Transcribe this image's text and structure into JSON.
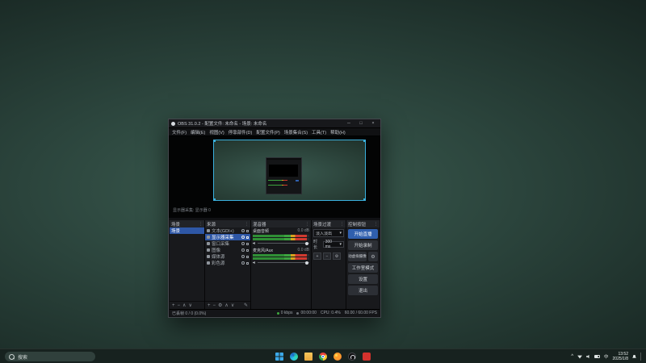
{
  "icons": {
    "minimize": "─",
    "maximize": "□",
    "close": "×",
    "menu_dots": "⋮",
    "plus": "+",
    "minus": "−",
    "gear": "⚙",
    "up": "∧",
    "down": "∨",
    "caret": "▾",
    "edit": "✎",
    "chevron_up": "^"
  },
  "colors": {
    "accent_blue": "#2f5fae",
    "selection_blue": "#2e57a6",
    "preview_outline": "#3ab0dd",
    "meter_green": "#3da33f",
    "meter_yellow": "#d8a21f",
    "meter_red": "#cf3a30"
  },
  "obs": {
    "title": "OBS 31.0.2 - 配置文件: 未命名 - 场景: 未命名",
    "menu": [
      "文件(F)",
      "编辑(E)",
      "视图(V)",
      "停靠部件(D)",
      "配置文件(P)",
      "场景集合(S)",
      "工具(T)",
      "帮助(H)"
    ],
    "preview": {
      "toolbar_text": "显示器采集: 显示器 0"
    },
    "scenes": {
      "title": "场景",
      "rows": [
        "场景"
      ]
    },
    "sources": {
      "title": "来源",
      "rows": [
        "文本(GDI+)",
        "显示器采集",
        "窗口采集",
        "图像",
        "媒体源",
        "彩色源"
      ]
    },
    "mixer": {
      "title": "混音器",
      "channels": [
        {
          "name": "桌面音频",
          "db": "0.0 dB"
        },
        {
          "name": "麦克风/Aux",
          "db": "0.0 dB"
        }
      ]
    },
    "transitions": {
      "title": "场景过渡",
      "selected": "淡入淡出",
      "duration_label": "时长",
      "duration": "300 ms"
    },
    "controls": {
      "title": "控制按钮",
      "stream": "开始直播",
      "record": "开始录制",
      "vcam": "启动虚拟摄像机",
      "studio": "工作室模式",
      "settings": "设置",
      "exit": "退出"
    },
    "status": {
      "dropped": "已丢帧 0 / 0 (0.0%)",
      "bitrate": "0 kbps",
      "timer": "00:00:00",
      "cpu": "CPU: 0.4%",
      "fps": "60.00 / 60.00 FPS"
    }
  },
  "taskbar": {
    "search": "搜索",
    "tray": {
      "lang": "中",
      "time": "13:52",
      "date": "2025/1/8"
    }
  }
}
